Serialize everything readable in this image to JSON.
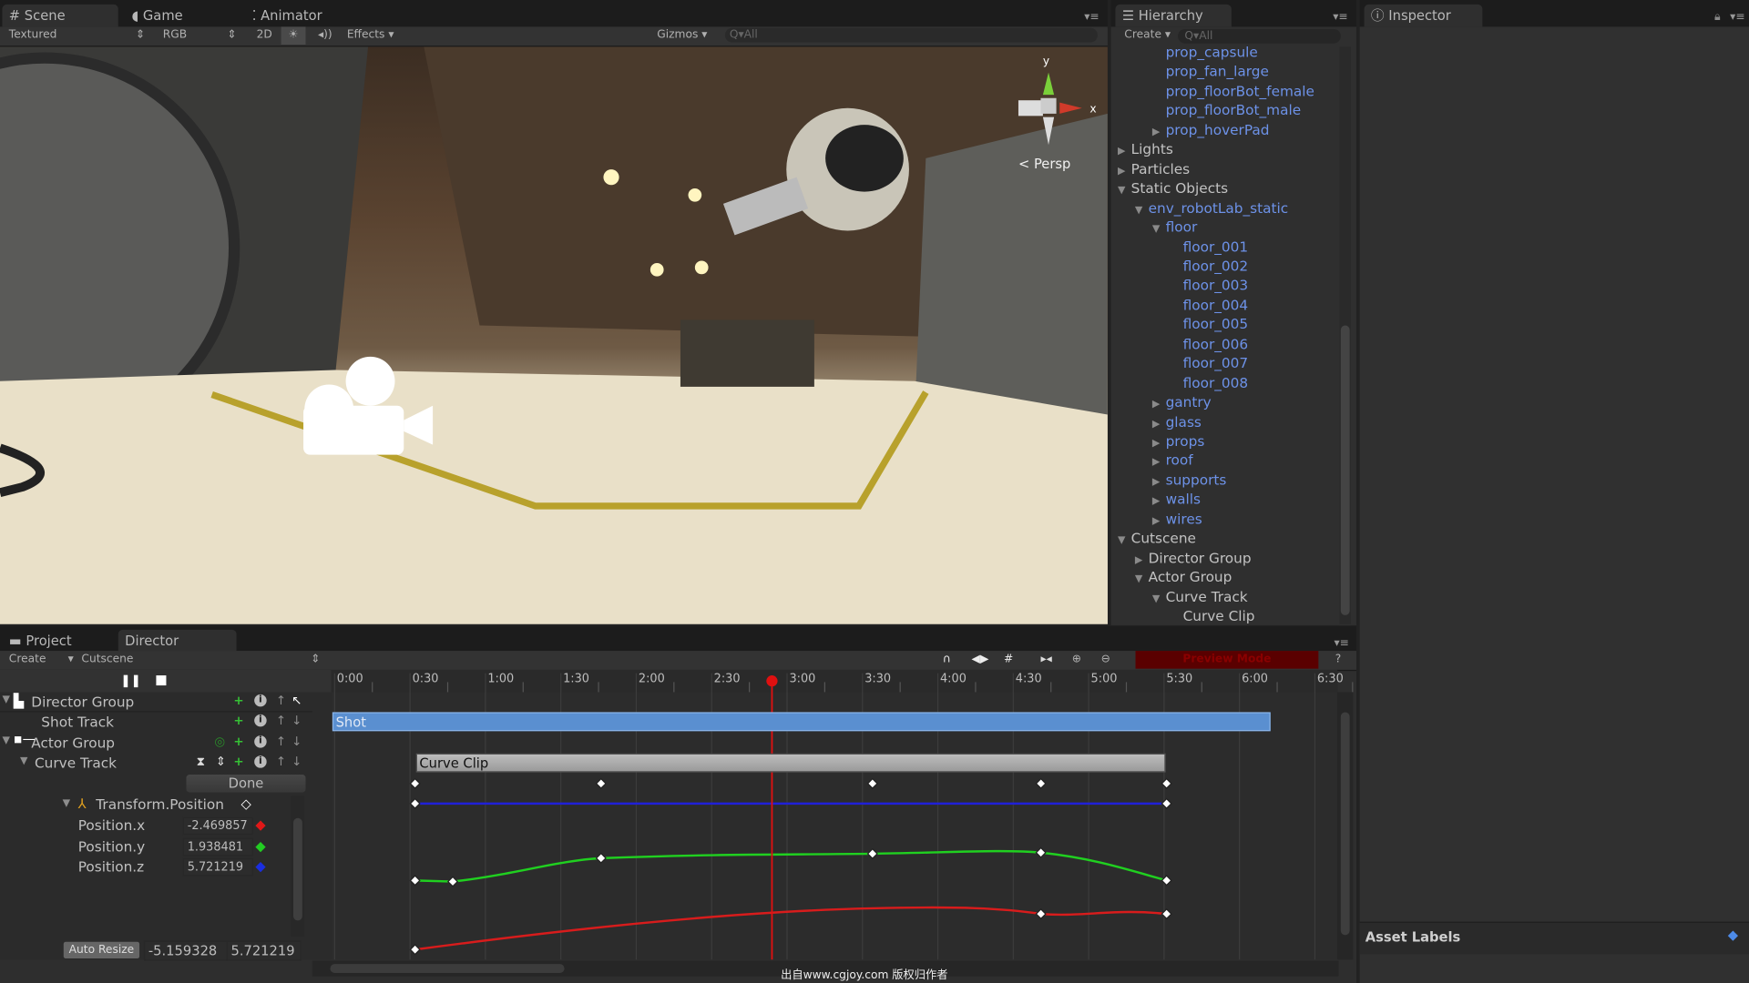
{
  "scene_tabs": [
    {
      "label": "Scene",
      "icon": "grid-icon"
    },
    {
      "label": "Game",
      "icon": "pacman-icon"
    },
    {
      "label": "Animator",
      "icon": "animator-icon"
    }
  ],
  "scene_toolbar": {
    "shading": "Textured",
    "render_mode": "RGB",
    "mode_2d": "2D",
    "effects": "Effects",
    "gizmos": "Gizmos",
    "search_placeholder": "All"
  },
  "gizmo": {
    "y_label": "y",
    "x_label": "x",
    "projection": "Persp"
  },
  "hierarchy": {
    "tab": "Hierarchy",
    "create": "Create",
    "search_placeholder": "All",
    "items": [
      {
        "label": "prop_capsule",
        "level": 2,
        "type": "prefab",
        "arrow": ""
      },
      {
        "label": "prop_fan_large",
        "level": 2,
        "type": "prefab",
        "arrow": ""
      },
      {
        "label": "prop_floorBot_female",
        "level": 2,
        "type": "prefab",
        "arrow": ""
      },
      {
        "label": "prop_floorBot_male",
        "level": 2,
        "type": "prefab",
        "arrow": ""
      },
      {
        "label": "prop_hoverPad",
        "level": 2,
        "type": "prefab",
        "arrow": "collapsed"
      },
      {
        "label": "Lights",
        "level": 0,
        "type": "plain",
        "arrow": "collapsed"
      },
      {
        "label": "Particles",
        "level": 0,
        "type": "plain",
        "arrow": "collapsed"
      },
      {
        "label": "Static Objects",
        "level": 0,
        "type": "plain",
        "arrow": "expanded"
      },
      {
        "label": "env_robotLab_static",
        "level": 1,
        "type": "prefab",
        "arrow": "expanded"
      },
      {
        "label": "floor",
        "level": 2,
        "type": "prefab",
        "arrow": "expanded"
      },
      {
        "label": "floor_001",
        "level": 3,
        "type": "prefab",
        "arrow": ""
      },
      {
        "label": "floor_002",
        "level": 3,
        "type": "prefab",
        "arrow": ""
      },
      {
        "label": "floor_003",
        "level": 3,
        "type": "prefab",
        "arrow": ""
      },
      {
        "label": "floor_004",
        "level": 3,
        "type": "prefab",
        "arrow": ""
      },
      {
        "label": "floor_005",
        "level": 3,
        "type": "prefab",
        "arrow": ""
      },
      {
        "label": "floor_006",
        "level": 3,
        "type": "prefab",
        "arrow": ""
      },
      {
        "label": "floor_007",
        "level": 3,
        "type": "prefab",
        "arrow": ""
      },
      {
        "label": "floor_008",
        "level": 3,
        "type": "prefab",
        "arrow": ""
      },
      {
        "label": "gantry",
        "level": 2,
        "type": "prefab",
        "arrow": "collapsed"
      },
      {
        "label": "glass",
        "level": 2,
        "type": "prefab",
        "arrow": "collapsed"
      },
      {
        "label": "props",
        "level": 2,
        "type": "prefab",
        "arrow": "collapsed"
      },
      {
        "label": "roof",
        "level": 2,
        "type": "prefab",
        "arrow": "collapsed"
      },
      {
        "label": "supports",
        "level": 2,
        "type": "prefab",
        "arrow": "collapsed"
      },
      {
        "label": "walls",
        "level": 2,
        "type": "prefab",
        "arrow": "collapsed"
      },
      {
        "label": "wires",
        "level": 2,
        "type": "prefab",
        "arrow": "collapsed"
      },
      {
        "label": "Cutscene",
        "level": 0,
        "type": "plain",
        "arrow": "expanded"
      },
      {
        "label": "Director Group",
        "level": 1,
        "type": "plain",
        "arrow": "collapsed"
      },
      {
        "label": "Actor Group",
        "level": 1,
        "type": "plain",
        "arrow": "expanded"
      },
      {
        "label": "Curve Track",
        "level": 2,
        "type": "plain",
        "arrow": "expanded"
      },
      {
        "label": "Curve Clip",
        "level": 3,
        "type": "plain",
        "arrow": ""
      }
    ]
  },
  "inspector": {
    "tab": "Inspector",
    "asset_labels": "Asset Labels"
  },
  "bottom_tabs": {
    "project": "Project",
    "director": "Director"
  },
  "director": {
    "create": "Create",
    "cutscene": "Cutscene",
    "preview_mode": "Preview Mode",
    "help": "?",
    "time_ticks": [
      "0:00",
      "0:30",
      "1:00",
      "1:30",
      "2:00",
      "2:30",
      "3:00",
      "3:30",
      "4:00",
      "4:30",
      "5:00",
      "5:30",
      "6:00",
      "6:30"
    ],
    "playhead_time": "2:54",
    "tracks": {
      "director_group": "Director Group",
      "shot_track": "Shot Track",
      "actor_group": "Actor Group",
      "curve_track": "Curve Track"
    },
    "done": "Done",
    "property": "Transform.Position",
    "fields": [
      {
        "label": "Position.x",
        "value": "-2.469857",
        "color": "#e01818"
      },
      {
        "label": "Position.y",
        "value": "1.938481",
        "color": "#22cc22"
      },
      {
        "label": "Position.z",
        "value": "5.721219",
        "color": "#1a2ee0"
      }
    ],
    "auto_resize": "Auto Resize",
    "range_min": "-5.159328",
    "range_max": "5.721219",
    "shot_clip": "Shot",
    "curve_clip": "Curve Clip",
    "keyframe_times_s": [
      32,
      47,
      106,
      214,
      281,
      331
    ]
  },
  "watermark": "出自www.cgjoy.com 版权归作者"
}
